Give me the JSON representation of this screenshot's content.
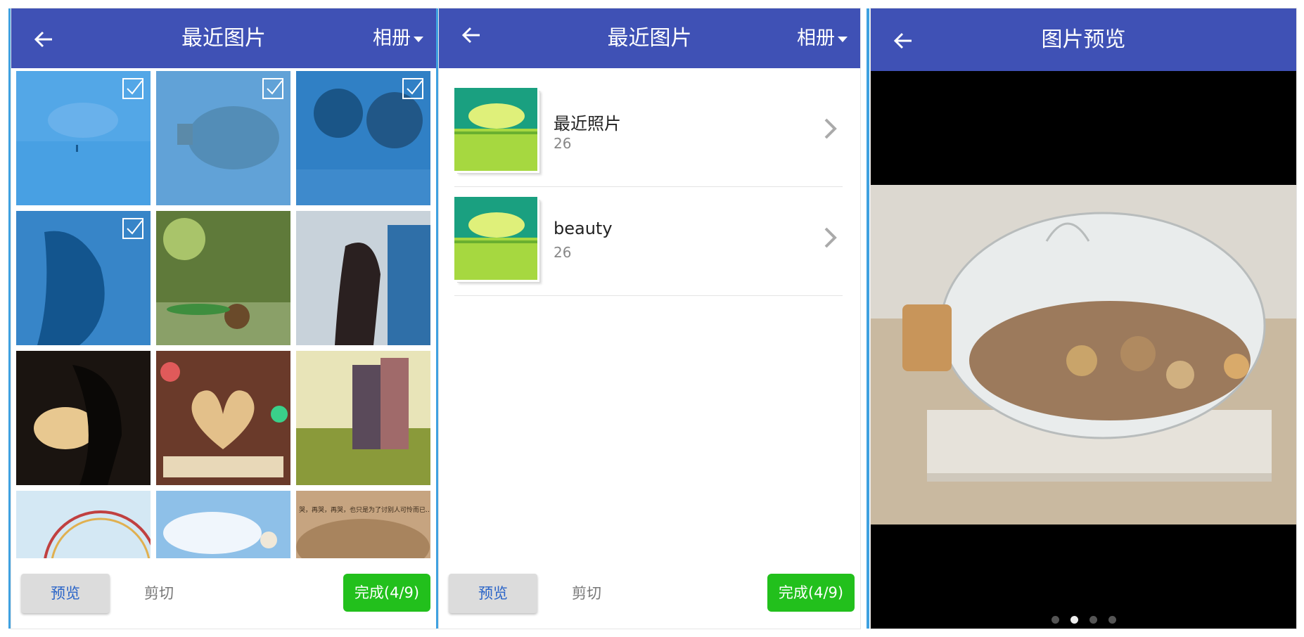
{
  "panels": [
    {
      "title": "最近图片",
      "album_label": "相册",
      "tiles": [
        {
          "name": "tile-sea-horizon",
          "selected": true
        },
        {
          "name": "tile-glass-pig",
          "selected": true
        },
        {
          "name": "tile-couple-kiss",
          "selected": true
        },
        {
          "name": "tile-wet-hair",
          "selected": true
        },
        {
          "name": "tile-snail",
          "selected": false
        },
        {
          "name": "tile-girl-bus",
          "selected": false
        },
        {
          "name": "tile-silhouette",
          "selected": false
        },
        {
          "name": "tile-book-heart",
          "selected": false
        },
        {
          "name": "tile-holding-hands",
          "selected": false
        },
        {
          "name": "tile-ferris-wheel",
          "selected": false
        },
        {
          "name": "tile-sky-clouds",
          "selected": false
        },
        {
          "name": "tile-sand-text",
          "selected": false
        }
      ],
      "sand_text": "哭，再哭，再哭，也只是为了讨别人可怜而已……",
      "preview_label": "预览",
      "cut_label": "剪切",
      "done_label": "完成(4/9)"
    },
    {
      "title": "最近图片",
      "album_label": "相册",
      "albums": [
        {
          "name": "最近照片",
          "count": "26"
        },
        {
          "name": "beauty",
          "count": "26"
        }
      ],
      "preview_label": "预览",
      "cut_label": "剪切",
      "done_label": "完成(4/9)"
    },
    {
      "title": "图片预览",
      "page_count": 4,
      "current_page": 2
    }
  ],
  "colors": {
    "header": "#3f51b5",
    "done_button": "#22c01c",
    "selection_overlay": "#0078dc",
    "preview_text": "#2a64c8"
  }
}
